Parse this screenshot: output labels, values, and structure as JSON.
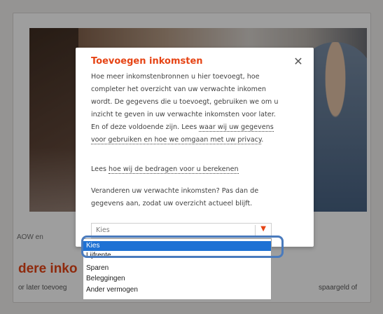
{
  "background": {
    "aow_text": "AOW en",
    "more_title": "dere inko",
    "later_text": "or later toevoeg",
    "right_text": "spaargeld of"
  },
  "modal": {
    "title": "Toevoegen inkomsten",
    "close_icon": "close-icon",
    "para1_line1": "Hoe meer inkomstenbronnen u hier toevoegt, hoe",
    "para1_line2": "completer het overzicht van uw verwachte inkomen",
    "para1_line3": "wordt. De gegevens die u toevoegt, gebruiken we om u",
    "para1_line4": "inzicht te geven in uw verwachte inkomsten voor later.",
    "para1_line5_start": "En of deze voldoende zijn. Lees ",
    "para1_link": "waar wij uw gegevens",
    "para1_link2": "voor gebruiken en hoe we omgaan met uw privacy",
    "para1_end": ".",
    "para2_start": "Lees ",
    "para2_link": "hoe wij de bedragen voor u berekenen",
    "para3_line1": "Veranderen uw verwachte inkomsten? Pas dan de",
    "para3_line2": "gegevens aan, zodat uw overzicht actueel blijft."
  },
  "select": {
    "value": "Kies",
    "accent_color": "#e64415"
  },
  "dropdown": {
    "options": [
      "Kies",
      "Lijfrente",
      "Sparen",
      "Beleggingen",
      "Ander vermogen"
    ],
    "selected_index": 0,
    "selected_color": "#1e71d4"
  }
}
